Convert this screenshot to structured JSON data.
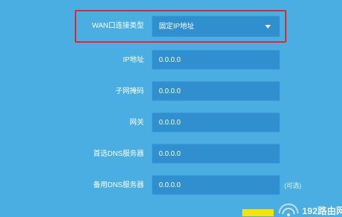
{
  "wan": {
    "label": "WAN口连接类型",
    "selected": "固定IP地址"
  },
  "fields": {
    "ip": {
      "label": "IP地址",
      "value": "0.0.0.0"
    },
    "subnet": {
      "label": "子网掩码",
      "value": "0.0.0.0"
    },
    "gateway": {
      "label": "网关",
      "value": "0.0.0.0"
    },
    "dns1": {
      "label": "首选DNS服务器",
      "value": "0.0.0.0"
    },
    "dns2": {
      "label": "备用DNS服务器",
      "value": "0.0.0.0",
      "note": "(可选)"
    }
  },
  "watermark": {
    "text": "192路由网"
  },
  "colors": {
    "background": "#4aaee3",
    "field": "#2f8fcf",
    "highlight": "#e2232a",
    "button": "#f6e400"
  },
  "icons": {
    "select_caret": "chevron-down-icon"
  }
}
